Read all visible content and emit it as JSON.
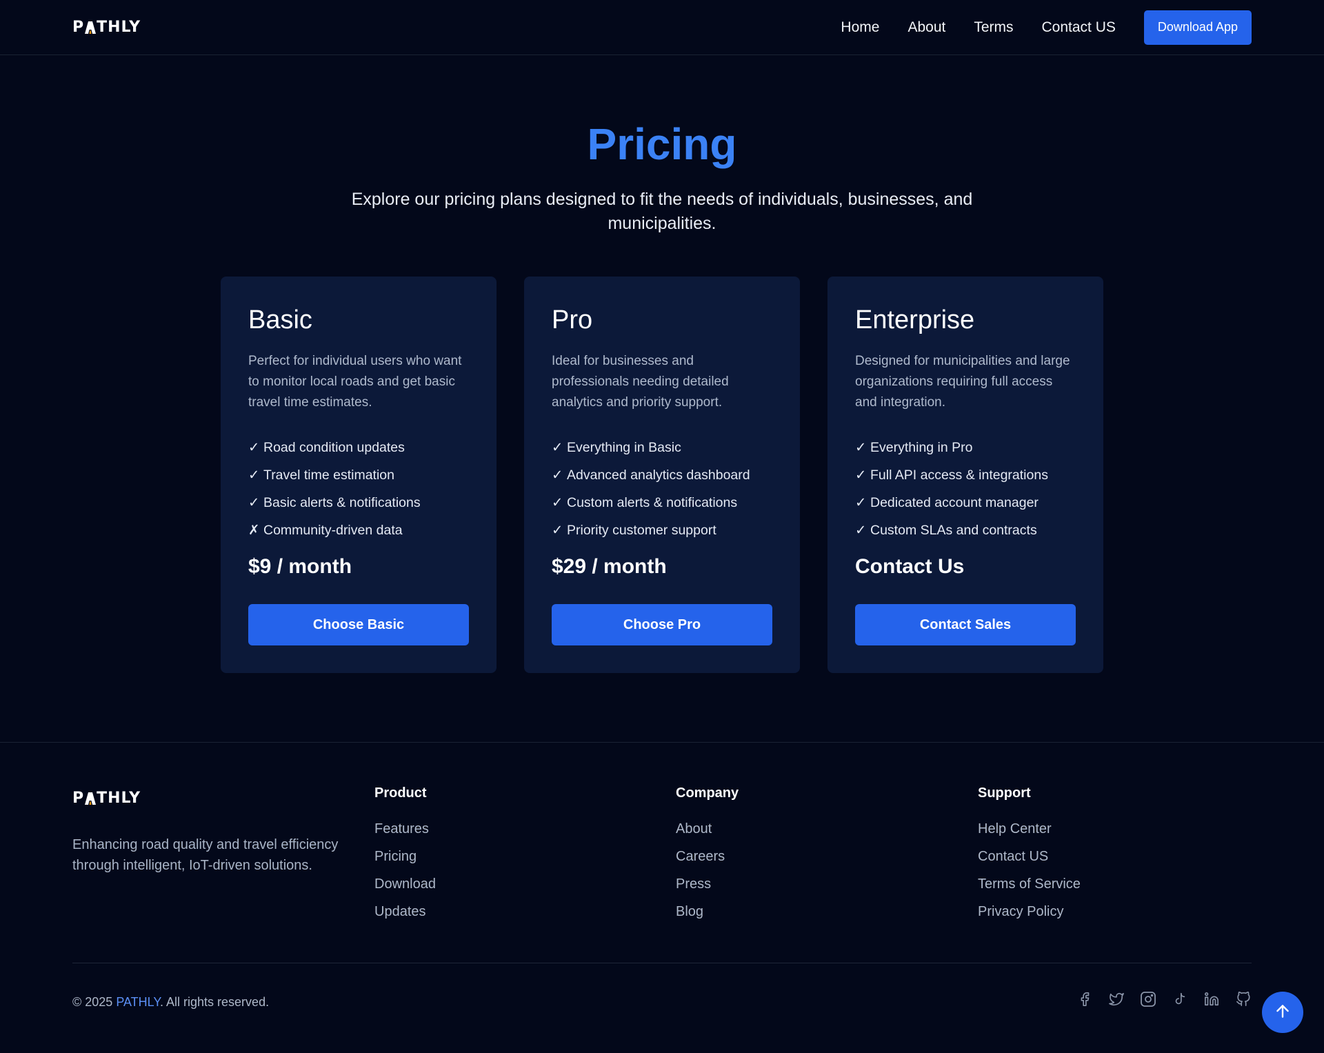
{
  "brand": {
    "logo_text_left": "P",
    "logo_text_right": "THLY",
    "logo_icon": "road-a-icon",
    "accent_color": "#2563eb",
    "title_color": "#3b82f6"
  },
  "nav": {
    "links": [
      "Home",
      "About",
      "Terms",
      "Contact US"
    ],
    "download_label": "Download App"
  },
  "hero": {
    "title": "Pricing",
    "subtitle": "Explore our pricing plans designed to fit the needs of individuals, businesses, and municipalities."
  },
  "plans": [
    {
      "name": "Basic",
      "description": "Perfect for individual users who want to monitor local roads and get basic travel time estimates.",
      "features": [
        {
          "mark": "✓",
          "text": "Road condition updates"
        },
        {
          "mark": "✓",
          "text": "Travel time estimation"
        },
        {
          "mark": "✓",
          "text": "Basic alerts & notifications"
        },
        {
          "mark": "✗",
          "text": "Community-driven data"
        }
      ],
      "price": "$9 / month",
      "button": "Choose Basic"
    },
    {
      "name": "Pro",
      "description": "Ideal for businesses and professionals needing detailed analytics and priority support.",
      "features": [
        {
          "mark": "✓",
          "text": "Everything in Basic"
        },
        {
          "mark": "✓",
          "text": "Advanced analytics dashboard"
        },
        {
          "mark": "✓",
          "text": "Custom alerts & notifications"
        },
        {
          "mark": "✓",
          "text": "Priority customer support"
        }
      ],
      "price": "$29 / month",
      "button": "Choose Pro"
    },
    {
      "name": "Enterprise",
      "description": "Designed for municipalities and large organizations requiring full access and integration.",
      "features": [
        {
          "mark": "✓",
          "text": "Everything in Pro"
        },
        {
          "mark": "✓",
          "text": "Full API access & integrations"
        },
        {
          "mark": "✓",
          "text": "Dedicated account manager"
        },
        {
          "mark": "✓",
          "text": "Custom SLAs and contracts"
        }
      ],
      "price": "Contact Us",
      "button": "Contact Sales"
    }
  ],
  "footer": {
    "tagline": "Enhancing road quality and travel efficiency through intelligent, IoT-driven solutions.",
    "columns": [
      {
        "title": "Product",
        "links": [
          "Features",
          "Pricing",
          "Download",
          "Updates"
        ]
      },
      {
        "title": "Company",
        "links": [
          "About",
          "Careers",
          "Press",
          "Blog"
        ]
      },
      {
        "title": "Support",
        "links": [
          "Help Center",
          "Contact US",
          "Terms of Service",
          "Privacy Policy"
        ]
      }
    ],
    "copyright_prefix": "© 2025 ",
    "copyright_brand": "PATHLY",
    "copyright_suffix": ". All rights reserved.",
    "socials": [
      "facebook-icon",
      "twitter-icon",
      "instagram-icon",
      "tiktok-icon",
      "linkedin-icon",
      "github-icon"
    ],
    "scroll_top_icon": "arrow-up-icon"
  }
}
